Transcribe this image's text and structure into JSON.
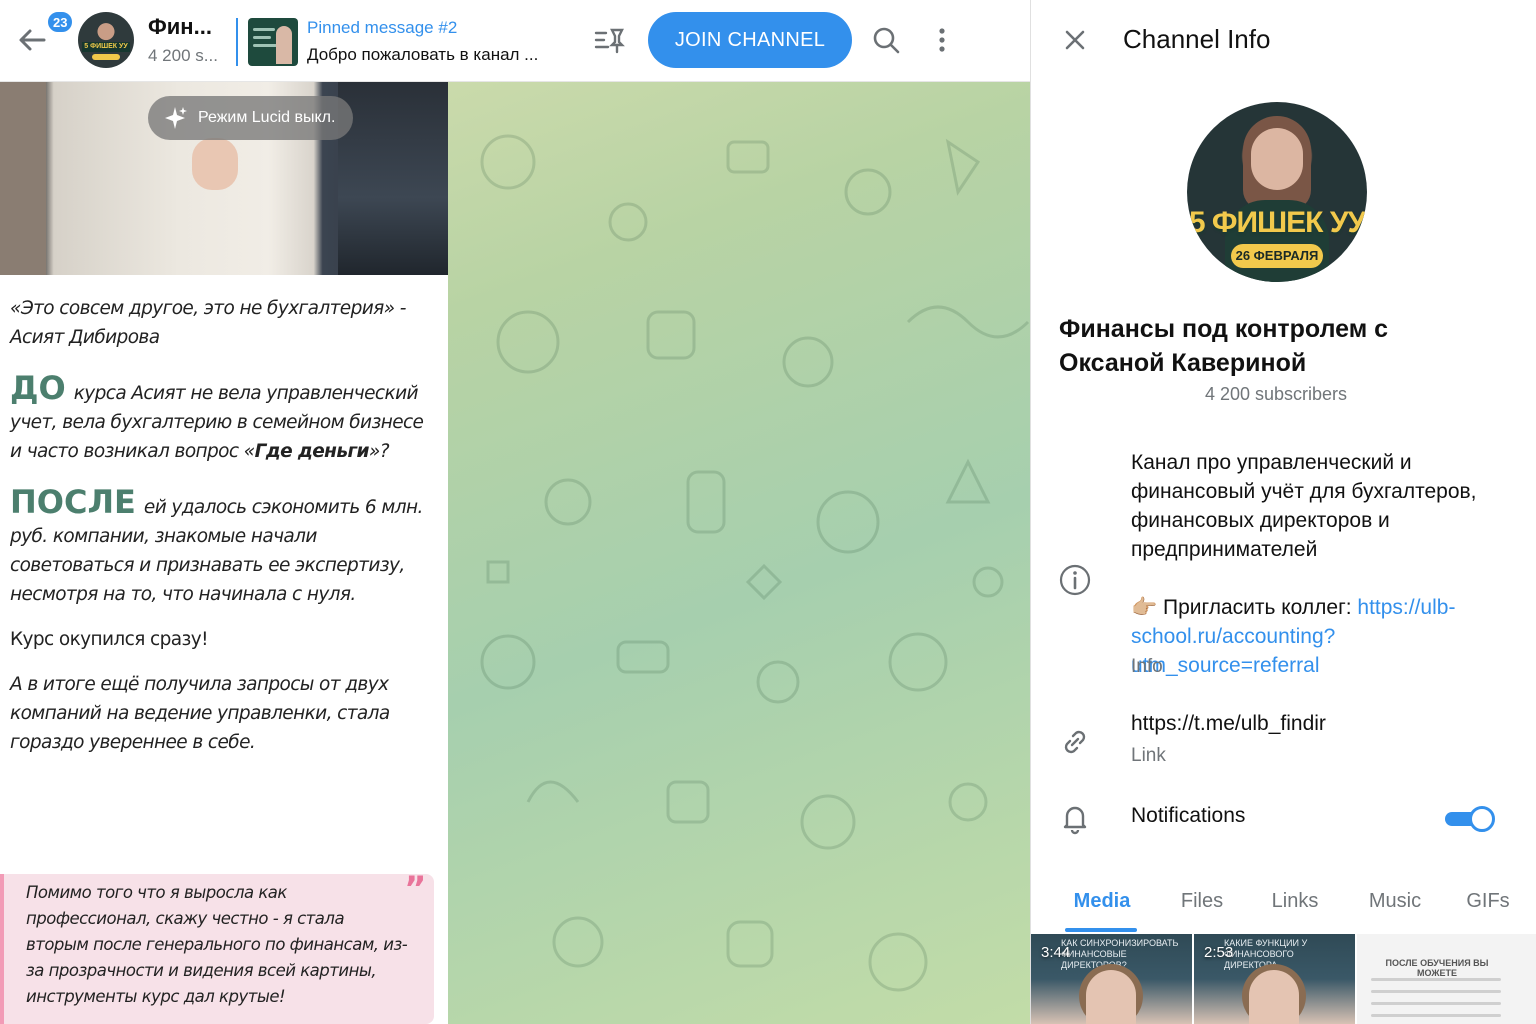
{
  "header": {
    "unread_count": "23",
    "title": "Фин...",
    "subtitle": "4 200 s...",
    "pinned_label": "Pinned message #2",
    "pinned_text": "Добро пожаловать в канал ...",
    "join_label": "JOIN CHANNEL",
    "avatar_band": "5 ФИШЕК УУ"
  },
  "post": {
    "lucid_label": "Режим Lucid выкл.",
    "quote_intro": "«Это  совсем другое, это не бухгалтерия» - Асият Дибирова",
    "before_word": "ДО",
    "before_text_1": "курса Асият не вела управленческий учет, вела бухгалтерию в семейном бизнесе и часто возникал вопрос «",
    "before_bold": "Где деньги",
    "before_text_2": "»?",
    "after_word": "ПОСЛЕ",
    "after_text": "ей удалось сэкономить 6 млн. руб. компании, знакомые начали советоваться и признавать ее экспертизу, несмотря на то, что начинала с нуля.",
    "payoff": "Курс окупился сразу!",
    "result": "А в итоге ещё получила запросы от двух компаний на ведение управленки, стала гораздо увереннее в себе.",
    "quote": "Помимо того что я выросла как профессионал, скажу честно - я стала вторым после генерального по финансам, из-за прозрачности и видения всей картины, инструменты курс дал крутые!",
    "quote_mark": "”"
  },
  "panel": {
    "title": "Channel Info",
    "avatar_text": "5 ФИШЕК УУ",
    "avatar_date": "26 ФЕВРАЛЯ",
    "channel_name": "Финансы под контролем с Оксаной Кавериной",
    "subscribers": "4 200 subscribers",
    "description": "Канал про управленческий и финансовый учёт для бухгалтеров, финансовых директоров и предпринимателей",
    "invite_emoji": "👉🏼",
    "invite_text": " Пригласить коллег: ",
    "invite_link": "https://ulb-school.ru/accounting?utm_source=referral",
    "info_caption": "Info",
    "link_value": "https://t.me/ulb_findir",
    "link_caption": "Link",
    "notifications_label": "Notifications",
    "notifications_on": true
  },
  "tabs": [
    "Media",
    "Files",
    "Links",
    "Music",
    "GIFs"
  ],
  "active_tab": "Media",
  "media": [
    {
      "duration": "3:44",
      "caption": "Как синхронизировать финансовые директоров?"
    },
    {
      "duration": "2:53",
      "caption": "Какие функции у финансового директора"
    },
    {
      "doc_title": "ПОСЛЕ ОБУЧЕНИЯ ВЫ МОЖЕТЕ"
    }
  ],
  "colors": {
    "accent": "#3390ec",
    "green_heading": "#4c7f6e",
    "quote_bg": "#f7e1e8",
    "quote_border": "#f29bb6"
  }
}
